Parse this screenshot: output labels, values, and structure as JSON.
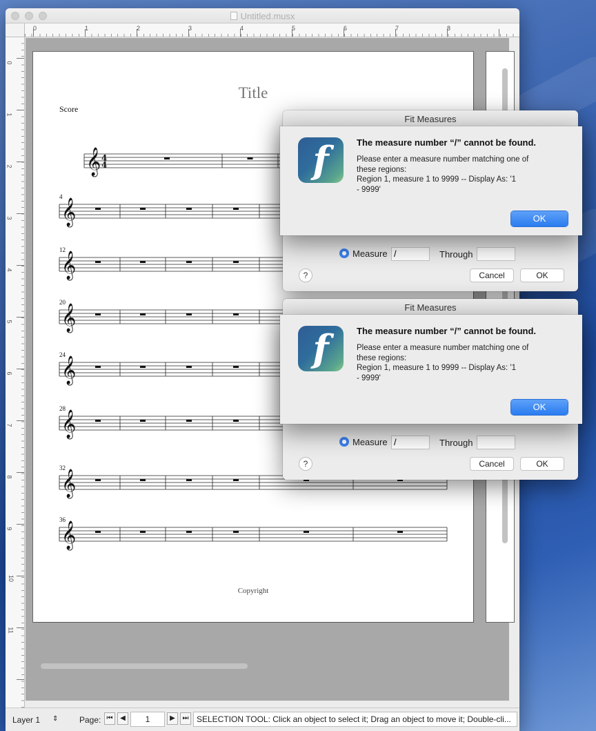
{
  "window": {
    "title": "Untitled.musx"
  },
  "ruler": {
    "horizontal": [
      "0",
      "1",
      "2",
      "3",
      "4",
      "5",
      "6",
      "7",
      "8"
    ],
    "vertical": [
      "0",
      "1",
      "2",
      "3",
      "4",
      "5",
      "6",
      "7",
      "8",
      "9",
      "10",
      "11"
    ]
  },
  "score": {
    "title": "Title",
    "part_name": "Score",
    "copyright": "Copyright",
    "time_signature": [
      "4",
      "4"
    ],
    "measure_numbers": [
      "4",
      "12",
      "20",
      "24",
      "28",
      "32",
      "36"
    ]
  },
  "status_bar": {
    "layer": "Layer 1",
    "page_label": "Page:",
    "page_number": "1",
    "message": "SELECTION TOOL: Click an object to select it; Drag an object to move it; Double-cli..."
  },
  "dialogs": [
    {
      "title": "Fit Measures",
      "measure_label": "Measure",
      "measure_value": "/",
      "through_label": "Through",
      "through_value": "",
      "help": "?",
      "cancel": "Cancel",
      "ok": "OK"
    },
    {
      "title": "Fit Measures",
      "measure_label": "Measure",
      "measure_value": "/",
      "through_label": "Through",
      "through_value": "",
      "help": "?",
      "cancel": "Cancel",
      "ok": "OK"
    }
  ],
  "alerts": [
    {
      "icon": "f",
      "heading": "The measure number “/” cannot be found.",
      "body": [
        "Please enter a measure number matching one of",
        "these regions:",
        "Region   1, measure    1 to 9999 -- Display As: '1",
        "- 9999'"
      ],
      "ok": "OK"
    },
    {
      "icon": "f",
      "heading": "The measure number “/” cannot be found.",
      "body": [
        "Please enter a measure number matching one of",
        "these regions:",
        "Region   1, measure    1 to 9999 -- Display As: '1",
        "- 9999'"
      ],
      "ok": "OK"
    }
  ],
  "colors": {
    "accent": "#3c83f2",
    "app_icon_start": "#2f5d96",
    "app_icon_end": "#8cc98a"
  }
}
